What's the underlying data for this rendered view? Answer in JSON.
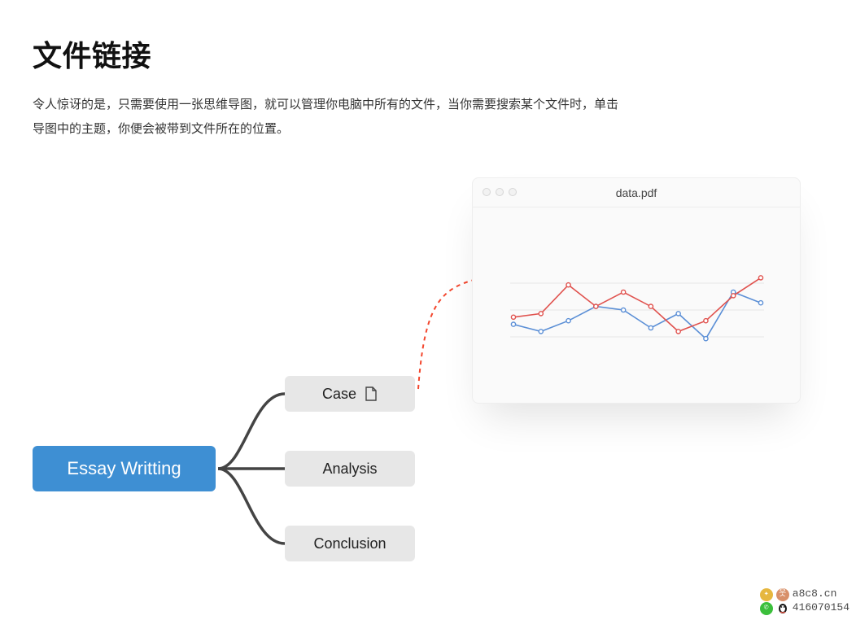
{
  "header": {
    "title": "文件链接",
    "description": "令人惊讶的是，只需要使用一张思维导图，就可以管理你电脑中所有的文件，当你需要搜索某个文件时，单击导图中的主题，你便会被带到文件所在的位置。"
  },
  "mindmap": {
    "root": "Essay Writting",
    "children": [
      "Case",
      "Analysis",
      "Conclusion"
    ],
    "attachment_on": 0
  },
  "preview": {
    "filename": "data.pdf"
  },
  "chart_data": {
    "type": "line",
    "x": [
      1,
      2,
      3,
      4,
      5,
      6,
      7,
      8,
      9,
      10
    ],
    "series": [
      {
        "name": "blue",
        "color": "#5b8fd6",
        "values": [
          22,
          18,
          24,
          32,
          30,
          20,
          28,
          14,
          40,
          34
        ]
      },
      {
        "name": "red",
        "color": "#e0524e",
        "values": [
          26,
          28,
          44,
          32,
          40,
          32,
          18,
          24,
          38,
          48
        ]
      }
    ],
    "ylim": [
      0,
      60
    ],
    "gridlines_y": [
      15,
      30,
      45
    ]
  },
  "contact": {
    "site": "a8c8.cn",
    "qq": "416070154"
  }
}
